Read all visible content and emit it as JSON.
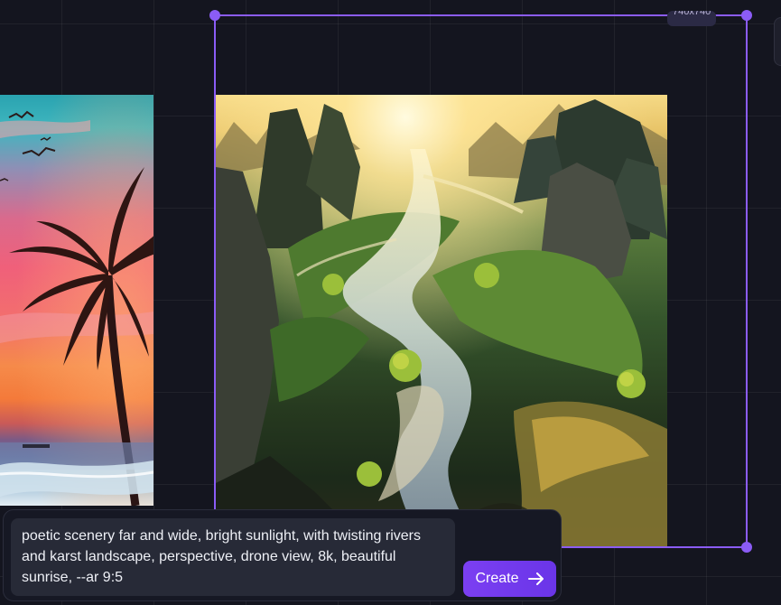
{
  "canvas": {
    "selection": {
      "size_label": "740x740",
      "accent_color": "#8b5cf6"
    },
    "images": [
      {
        "name": "sunset-palm-image"
      },
      {
        "name": "karst-river-image"
      }
    ]
  },
  "prompt": {
    "text": "poetic scenery far and wide, bright sunlight, with twisting rivers and karst landscape, perspective, drone view, 8k, beautiful sunrise, --ar 9:5",
    "create_label": "Create",
    "create_icon": "arrow-right-icon"
  }
}
